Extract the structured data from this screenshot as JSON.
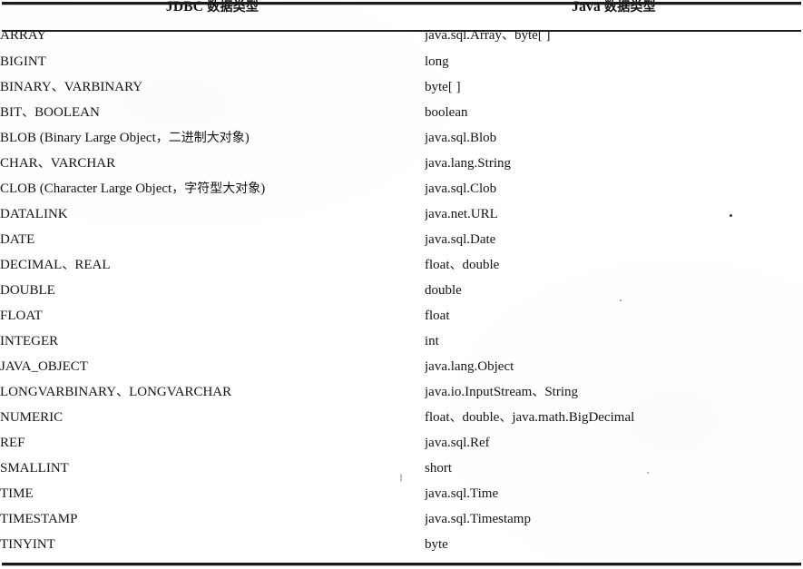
{
  "table": {
    "columns": [
      {
        "key": "jdbc",
        "label": "JDBC 数据类型"
      },
      {
        "key": "java",
        "label": "Java 数据类型"
      }
    ],
    "rows": [
      {
        "jdbc": "ARRAY",
        "java": "java.sql.Array、byte[ ]"
      },
      {
        "jdbc": "BIGINT",
        "java": "long"
      },
      {
        "jdbc": "BINARY、VARBINARY",
        "java": "byte[ ]"
      },
      {
        "jdbc": "BIT、BOOLEAN",
        "java": "boolean"
      },
      {
        "jdbc": "BLOB (Binary Large Object，二进制大对象)",
        "java": "java.sql.Blob"
      },
      {
        "jdbc": "CHAR、VARCHAR",
        "java": "java.lang.String"
      },
      {
        "jdbc": "CLOB (Character Large Object，字符型大对象)",
        "java": "java.sql.Clob"
      },
      {
        "jdbc": "DATALINK",
        "java": "java.net.URL"
      },
      {
        "jdbc": "DATE",
        "java": "java.sql.Date"
      },
      {
        "jdbc": "DECIMAL、REAL",
        "java": "float、double"
      },
      {
        "jdbc": "DOUBLE",
        "java": "double"
      },
      {
        "jdbc": "FLOAT",
        "java": "float"
      },
      {
        "jdbc": "INTEGER",
        "java": "int"
      },
      {
        "jdbc": "JAVA_OBJECT",
        "java": "java.lang.Object"
      },
      {
        "jdbc": "LONGVARBINARY、LONGVARCHAR",
        "java": "java.io.InputStream、String"
      },
      {
        "jdbc": "NUMERIC",
        "java": "float、double、java.math.BigDecimal"
      },
      {
        "jdbc": "REF",
        "java": "java.sql.Ref"
      },
      {
        "jdbc": "SMALLINT",
        "java": "short"
      },
      {
        "jdbc": "TIME",
        "java": "java.sql.Time"
      },
      {
        "jdbc": "TIMESTAMP",
        "java": "java.sql.Timestamp"
      },
      {
        "jdbc": "TINYINT",
        "java": "byte"
      }
    ]
  },
  "style": {
    "page_background": "#ffffff",
    "ink_color": "#141414",
    "rule_color": "#1a1a1a"
  }
}
